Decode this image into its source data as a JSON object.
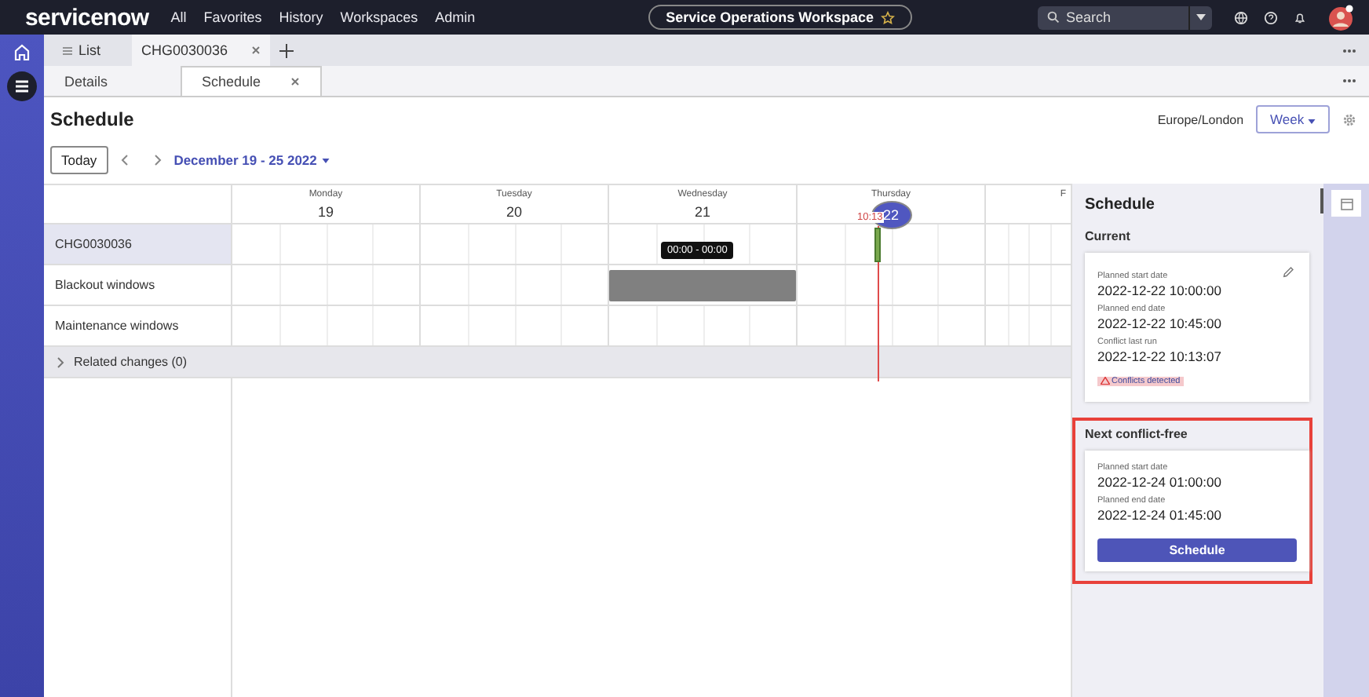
{
  "top_bar": {
    "logo": "servicenow",
    "menu": [
      "All",
      "Favorites",
      "History",
      "Workspaces",
      "Admin"
    ],
    "workspace": "Service Operations Workspace",
    "search": {
      "placeholder": "Search"
    }
  },
  "record_tabs": [
    {
      "label": "List",
      "selected": false,
      "closable": false
    },
    {
      "label": "CHG0030036",
      "selected": true,
      "closable": true
    }
  ],
  "sub_tabs": [
    {
      "label": "Details",
      "selected": false
    },
    {
      "label": "Schedule",
      "selected": true
    }
  ],
  "page": {
    "title": "Schedule",
    "timezone": "Europe/London",
    "view": "Week",
    "today_button": "Today",
    "date_range": "December 19 - 25 2022"
  },
  "calendar": {
    "days": [
      {
        "weekday": "Monday",
        "date": "19",
        "today": false
      },
      {
        "weekday": "Tuesday",
        "date": "20",
        "today": false
      },
      {
        "weekday": "Wednesday",
        "date": "21",
        "today": false
      },
      {
        "weekday": "Thursday",
        "date": "22",
        "today": true
      },
      {
        "weekday": "F"
      }
    ],
    "rows": [
      {
        "label": "CHG0030036",
        "selected": true
      },
      {
        "label": "Blackout windows",
        "selected": false
      },
      {
        "label": "Maintenance windows",
        "selected": false
      }
    ],
    "related": {
      "label": "Related changes (0)",
      "expanded": false
    },
    "now_label": "10:13",
    "tooltip": "00:00 - 00:00"
  },
  "schedule_panel": {
    "title": "Schedule",
    "sections": [
      {
        "heading": "Current",
        "highlighted": false,
        "editable": true,
        "fields": [
          {
            "label": "Planned start date",
            "value": "2022-12-22 10:00:00"
          },
          {
            "label": "Planned end date",
            "value": "2022-12-22 10:45:00"
          },
          {
            "label": "Conflict last run",
            "value": "2022-12-22 10:13:07"
          }
        ],
        "warning": "Conflicts detected"
      },
      {
        "heading": "Next conflict-free",
        "highlighted": true,
        "editable": false,
        "fields": [
          {
            "label": "Planned start date",
            "value": "2022-12-24 01:00:00"
          },
          {
            "label": "Planned end date",
            "value": "2022-12-24 01:45:00"
          }
        ],
        "button": "Schedule"
      }
    ]
  }
}
